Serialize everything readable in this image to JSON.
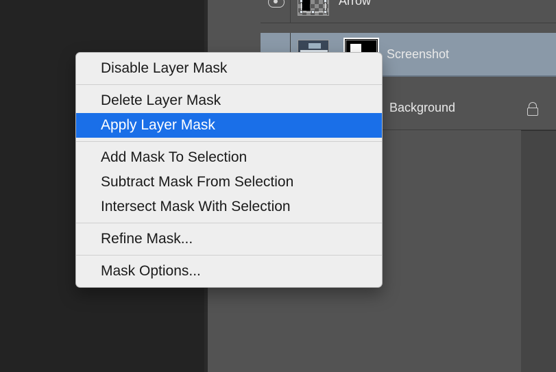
{
  "layers": {
    "arrow": {
      "name": "Arrow"
    },
    "screenshot": {
      "name": "Screenshot"
    },
    "background": {
      "name": "Background",
      "full_label": "Background"
    }
  },
  "context_menu": {
    "disable": "Disable Layer Mask",
    "delete": "Delete Layer Mask",
    "apply": "Apply Layer Mask",
    "add_sel": "Add Mask To Selection",
    "sub_sel": "Subtract Mask From Selection",
    "int_sel": "Intersect Mask With Selection",
    "refine": "Refine Mask...",
    "options": "Mask Options..."
  }
}
